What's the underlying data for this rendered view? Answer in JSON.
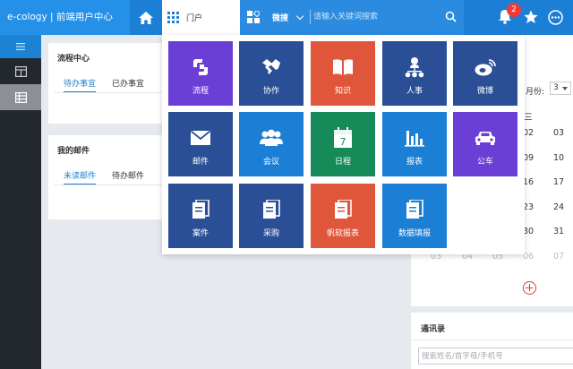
{
  "header": {
    "logo": "e-cology | 前端用户中心",
    "portal_tab_label": "门户",
    "search_type": "微搜",
    "search_placeholder": "请输入关键词搜索",
    "notification_count": "2"
  },
  "process_card": {
    "title": "流程中心",
    "tabs": [
      "待办事宜",
      "已办事宜"
    ]
  },
  "mail_card": {
    "title": "我的邮件",
    "tabs": [
      "未读邮件",
      "待办邮件"
    ]
  },
  "calendar": {
    "month_label": "月份:",
    "month_value": "3",
    "weekday": "三",
    "rows": [
      [
        "02",
        "03"
      ],
      [
        "09",
        "10"
      ],
      [
        "16",
        "17"
      ],
      [
        "23",
        "24"
      ],
      [
        "30",
        "31"
      ]
    ],
    "faded_row": [
      "03",
      "04",
      "05",
      "06",
      "07"
    ]
  },
  "contacts": {
    "title": "通讯录",
    "search_placeholder": "搜索姓名/首字母/手机号"
  },
  "portal_menu": {
    "tiles": [
      {
        "label": "流程",
        "icon": "process-icon",
        "color": "#6b3fd6"
      },
      {
        "label": "协作",
        "icon": "handshake-icon",
        "color": "#2b4f96"
      },
      {
        "label": "知识",
        "icon": "book-icon",
        "color": "#e0563a"
      },
      {
        "label": "人事",
        "icon": "org-chart-icon",
        "color": "#2b4f96"
      },
      {
        "label": "微博",
        "icon": "weibo-icon",
        "color": "#2b4f96"
      },
      {
        "label": "邮件",
        "icon": "mail-icon",
        "color": "#2b4f96"
      },
      {
        "label": "会议",
        "icon": "meeting-icon",
        "color": "#1c7fd6"
      },
      {
        "label": "日程",
        "icon": "calendar-icon",
        "color": "#178a5a",
        "icon_text": "7"
      },
      {
        "label": "报表",
        "icon": "bar-chart-icon",
        "color": "#1c7fd6"
      },
      {
        "label": "公车",
        "icon": "car-icon",
        "color": "#6b3fd6"
      },
      {
        "label": "案件",
        "icon": "document-icon",
        "color": "#2b4f96"
      },
      {
        "label": "采购",
        "icon": "document-icon",
        "color": "#2b4f96"
      },
      {
        "label": "帆软报表",
        "icon": "document-icon",
        "color": "#e0563a"
      },
      {
        "label": "数据填报",
        "icon": "document-icon",
        "color": "#1c7fd6"
      }
    ]
  }
}
